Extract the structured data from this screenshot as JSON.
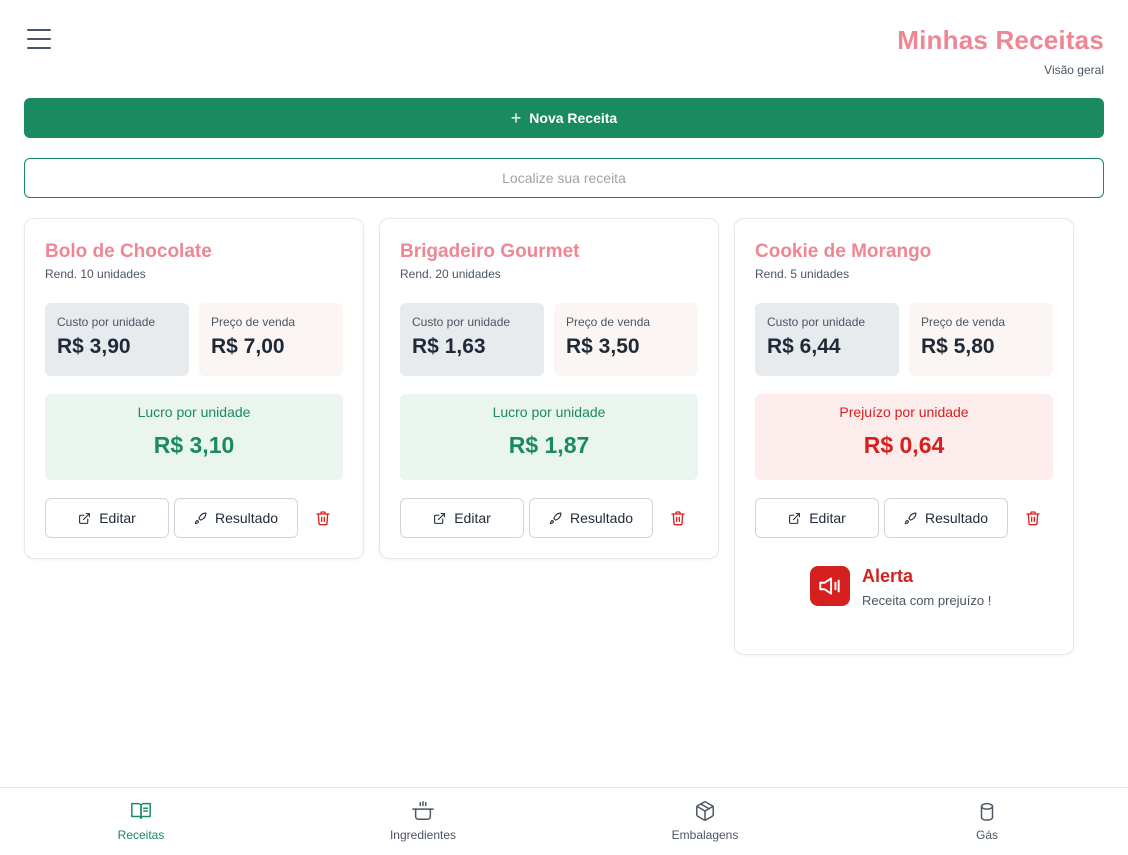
{
  "header": {
    "title": "Minhas Receitas",
    "subtitle": "Visão geral"
  },
  "actions": {
    "new_recipe_label": "Nova Receita",
    "search_placeholder": "Localize sua receita"
  },
  "recipes": [
    {
      "name": "Bolo de Chocolate",
      "yield": "Rend. 10 unidades",
      "cost_label": "Custo por unidade",
      "cost": "R$ 3,90",
      "price_label": "Preço de venda",
      "price": "R$ 7,00",
      "result_label": "Lucro por unidade",
      "result_value": "R$ 3,10",
      "status": "profit",
      "edit_label": "Editar",
      "result_button_label": "Resultado"
    },
    {
      "name": "Brigadeiro Gourmet",
      "yield": "Rend. 20 unidades",
      "cost_label": "Custo por unidade",
      "cost": "R$ 1,63",
      "price_label": "Preço de venda",
      "price": "R$ 3,50",
      "result_label": "Lucro por unidade",
      "result_value": "R$ 1,87",
      "status": "profit",
      "edit_label": "Editar",
      "result_button_label": "Resultado"
    },
    {
      "name": "Cookie de Morango",
      "yield": "Rend. 5 unidades",
      "cost_label": "Custo por unidade",
      "cost": "R$ 6,44",
      "price_label": "Preço de venda",
      "price": "R$ 5,80",
      "result_label": "Prejuízo por unidade",
      "result_value": "R$ 0,64",
      "status": "loss",
      "edit_label": "Editar",
      "result_button_label": "Resultado",
      "alert": {
        "title": "Alerta",
        "text": "Receita com prejuízo !"
      }
    }
  ],
  "bottom_nav": [
    {
      "label": "Receitas",
      "icon": "book-open-icon",
      "active": true
    },
    {
      "label": "Ingredientes",
      "icon": "cooking-pot-icon",
      "active": false
    },
    {
      "label": "Embalagens",
      "icon": "package-icon",
      "active": false
    },
    {
      "label": "Gás",
      "icon": "gas-cylinder-icon",
      "active": false
    }
  ],
  "colors": {
    "brand_green": "#1a8a60",
    "title_pink": "#ee8793",
    "loss_red": "#d6201f"
  }
}
